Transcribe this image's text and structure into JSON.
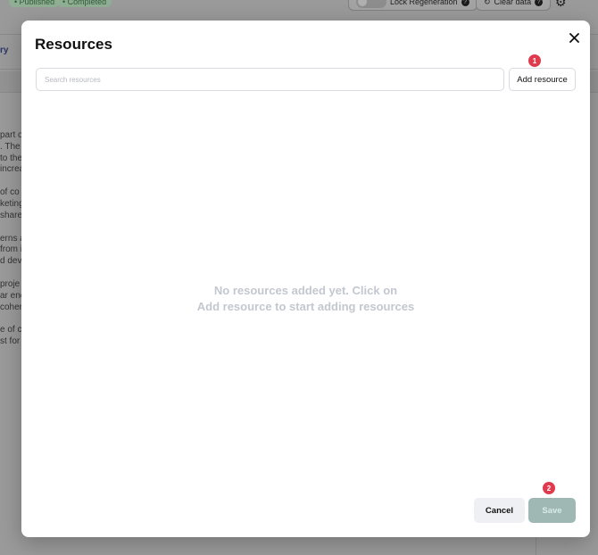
{
  "background": {
    "chips": [
      "• Published",
      "• Completed"
    ],
    "lock_label": "Lock Regeneration",
    "clear_label": "Clear data",
    "tab_label": "ry",
    "text_lines": [
      [
        "part o",
        ". The c",
        "to the",
        "increa"
      ],
      [
        "of co",
        "keting",
        "share"
      ],
      [
        "erns a",
        "from i",
        "d dev"
      ],
      [
        "proje",
        "ar enc",
        "coher"
      ],
      [
        "e of c",
        "st for"
      ]
    ]
  },
  "modal": {
    "title": "Resources",
    "search_placeholder": "Search resources",
    "add_button": "Add resource",
    "empty_line1": "No resources added yet. Click on",
    "empty_line2": "Add resource to start adding resources",
    "cancel_button": "Cancel",
    "save_button": "Save",
    "badge1": "1",
    "badge2": "2"
  },
  "icons": {
    "close": "close-icon",
    "gear": "gear-icon",
    "help": "help-icon",
    "lock": "lock-icon",
    "refresh": "refresh-icon"
  },
  "colors": {
    "badge": "#e03a4e",
    "save_disabled": "#9fb8b4"
  }
}
